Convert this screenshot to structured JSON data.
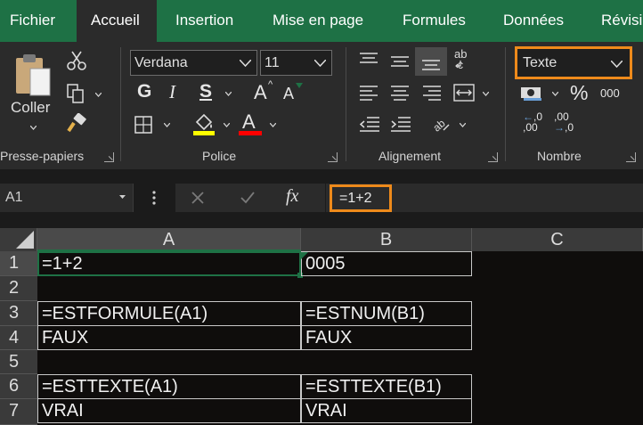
{
  "tabs": [
    {
      "label": "Fichier",
      "active": false
    },
    {
      "label": "Accueil",
      "active": true
    },
    {
      "label": "Insertion",
      "active": false
    },
    {
      "label": "Mise en page",
      "active": false
    },
    {
      "label": "Formules",
      "active": false
    },
    {
      "label": "Données",
      "active": false
    },
    {
      "label": "Révisio",
      "active": false
    }
  ],
  "ribbon": {
    "clipboard": {
      "paste_label": "Coller",
      "group_label": "Presse-papiers"
    },
    "font": {
      "family": "Verdana",
      "size": "11",
      "bold": "G",
      "italic": "I",
      "underline": "S",
      "grow": "A",
      "shrink": "A",
      "font_color_glyph": "A",
      "group_label": "Police",
      "highlight_color": "#ffff00",
      "text_color": "#ff0000"
    },
    "alignment": {
      "group_label": "Alignement",
      "wrap_glyph": "ab\nc"
    },
    "number": {
      "format": "Texte",
      "group_label": "Nombre",
      "percent": "%",
      "thousands": "000",
      "inc_decimal": "←0\n,00",
      "dec_decimal": ",00\n→,0"
    }
  },
  "formula_bar": {
    "name_box": "A1",
    "fx": "fx",
    "formula": "=1+2"
  },
  "grid": {
    "columns": [
      "A",
      "B",
      "C"
    ],
    "rows": [
      "1",
      "2",
      "3",
      "4",
      "5",
      "6",
      "7"
    ],
    "cells": {
      "A1": "=1+2",
      "B1": "0005",
      "A3": "=ESTFORMULE(A1)",
      "B3": "=ESTNUM(B1)",
      "A4": "FAUX",
      "B4": "FAUX",
      "A6": "=ESTTEXTE(A1)",
      "B6": "=ESTTEXTE(B1)",
      "A7": "VRAI",
      "B7": "VRAI"
    }
  },
  "colors": {
    "accent_green": "#1e7145",
    "highlight_orange": "#ee8a1b"
  }
}
